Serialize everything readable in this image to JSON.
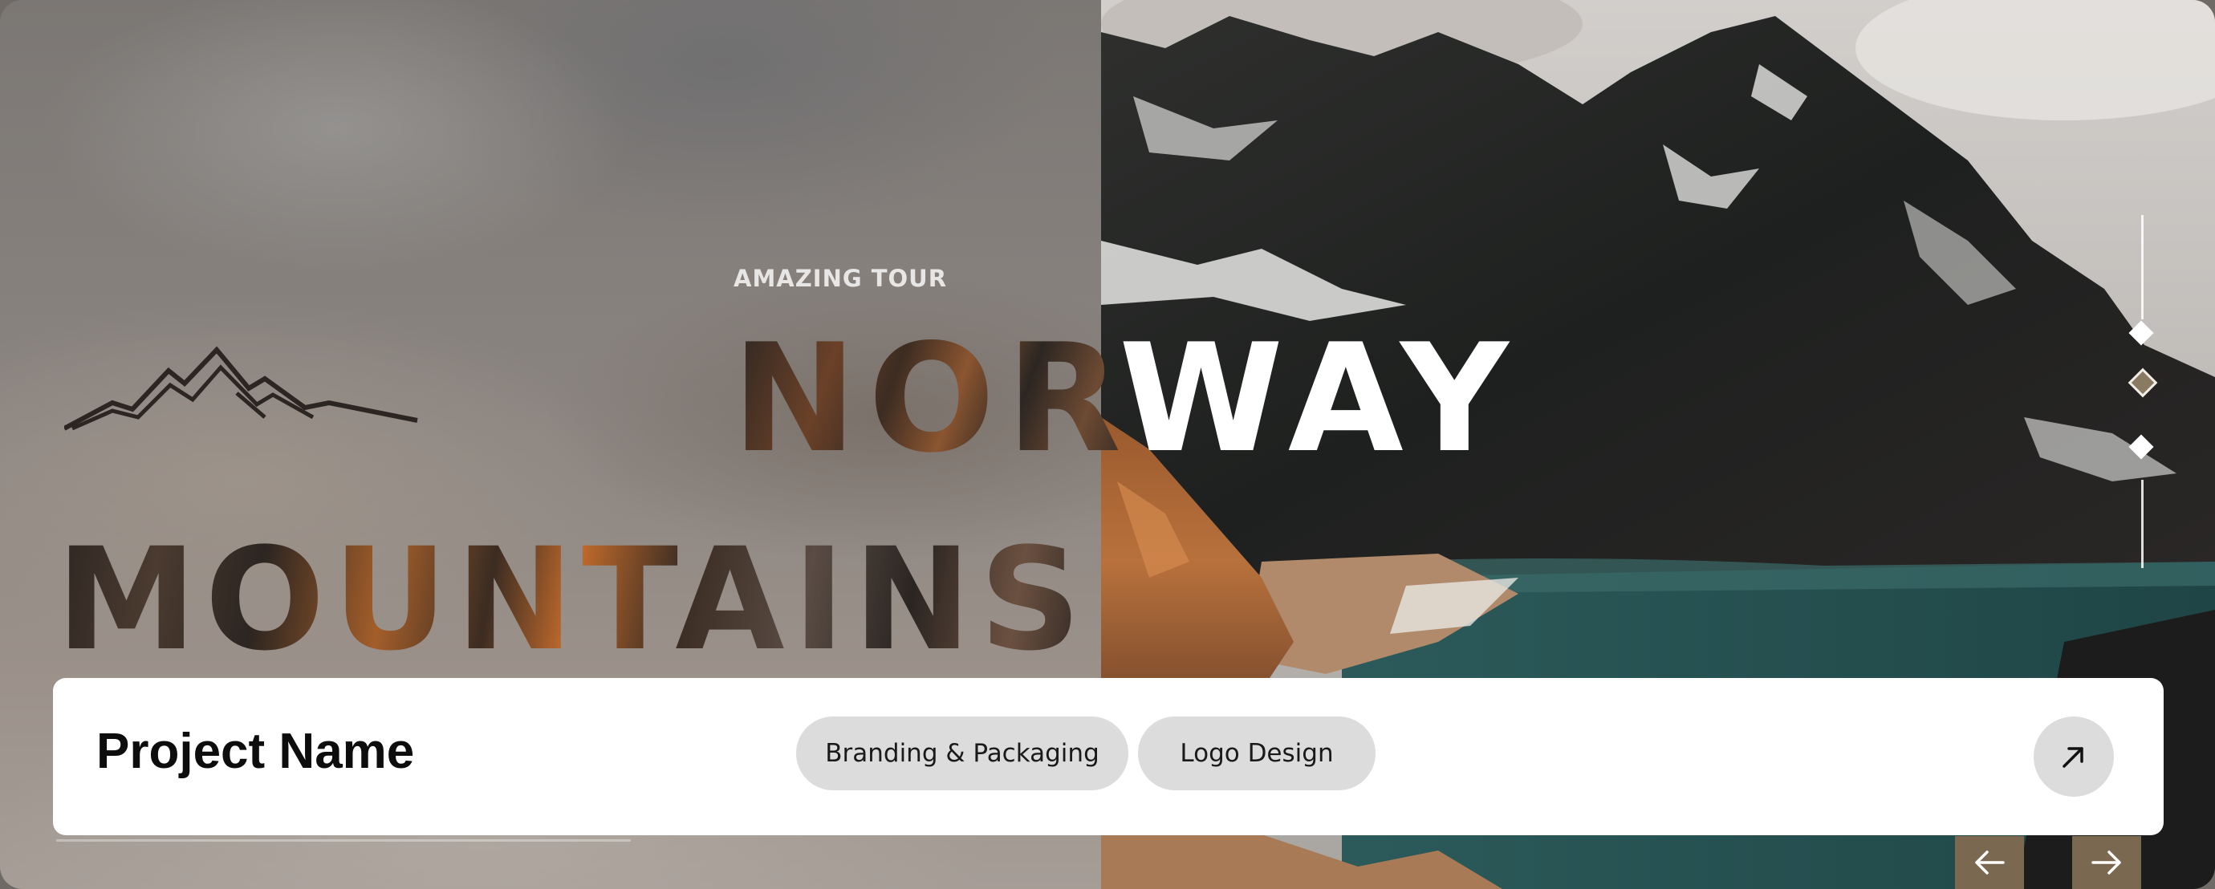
{
  "hero": {
    "tagline": "AMAZING TOUR",
    "word_left": "NOR",
    "word_right": "WAY",
    "word_bottom": "MOUNTAINS"
  },
  "slider": {
    "slides": 3,
    "active_index": 1
  },
  "project": {
    "name": "Project Name",
    "tags": [
      "Branding & Packaging",
      "Logo Design"
    ]
  },
  "icons": {
    "logo": "mountain-logo-icon",
    "open": "arrow-up-right-icon",
    "prev": "arrow-left-icon",
    "next": "arrow-right-icon"
  },
  "colors": {
    "bar_background": "#ffffff",
    "chip_background": "#dcdcdc",
    "nav_button": "#7a6850"
  }
}
